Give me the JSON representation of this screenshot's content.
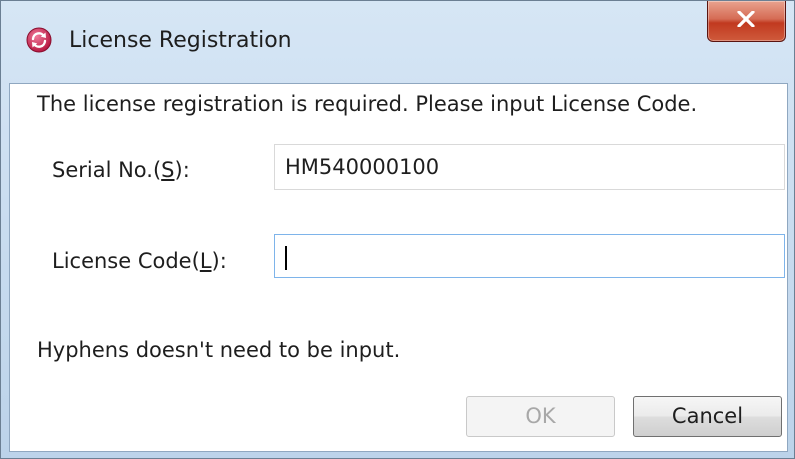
{
  "window": {
    "title": "License Registration",
    "close_label": "X"
  },
  "dialog": {
    "message": "The license registration is required. Please input License Code.",
    "serial": {
      "label_prefix": "Serial No.(",
      "label_mnemonic": "S",
      "label_suffix": "):",
      "value": "HM540000100"
    },
    "license": {
      "label_prefix": "License Code(",
      "label_mnemonic": "L",
      "label_suffix": "):",
      "value": ""
    },
    "hint": "Hyphens doesn't need to be input.",
    "ok_label": "OK",
    "cancel_label": "Cancel"
  },
  "colors": {
    "titlebar": "#c6daee",
    "close_button": "#c1391f",
    "input_focus_border": "#7eb4ea",
    "disabled_text": "#a8a8a8"
  },
  "icons": {
    "app": "refresh-cycle-icon",
    "close": "close-x-icon"
  }
}
